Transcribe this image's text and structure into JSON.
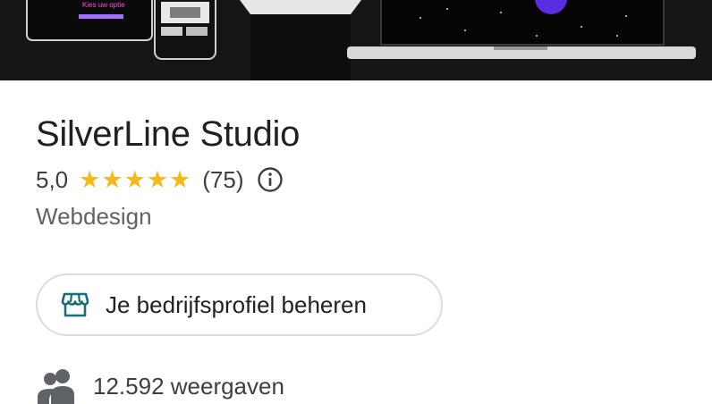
{
  "business": {
    "name": "SilverLine Studio",
    "rating": "5,0",
    "stars": 5,
    "review_count": "(75)",
    "category": "Webdesign"
  },
  "actions": {
    "manage_label": "Je bedrijfsprofiel beheren"
  },
  "stats": {
    "views_label": "12.592 weergaven"
  },
  "hero": {
    "screen_text": "Kies uw optie"
  },
  "icons": {
    "info": "info-icon",
    "store": "storefront-icon",
    "people": "people-icon"
  },
  "colors": {
    "star": "#f6b91a",
    "store_icon": "#1a6e7a",
    "border": "#dadce0"
  }
}
